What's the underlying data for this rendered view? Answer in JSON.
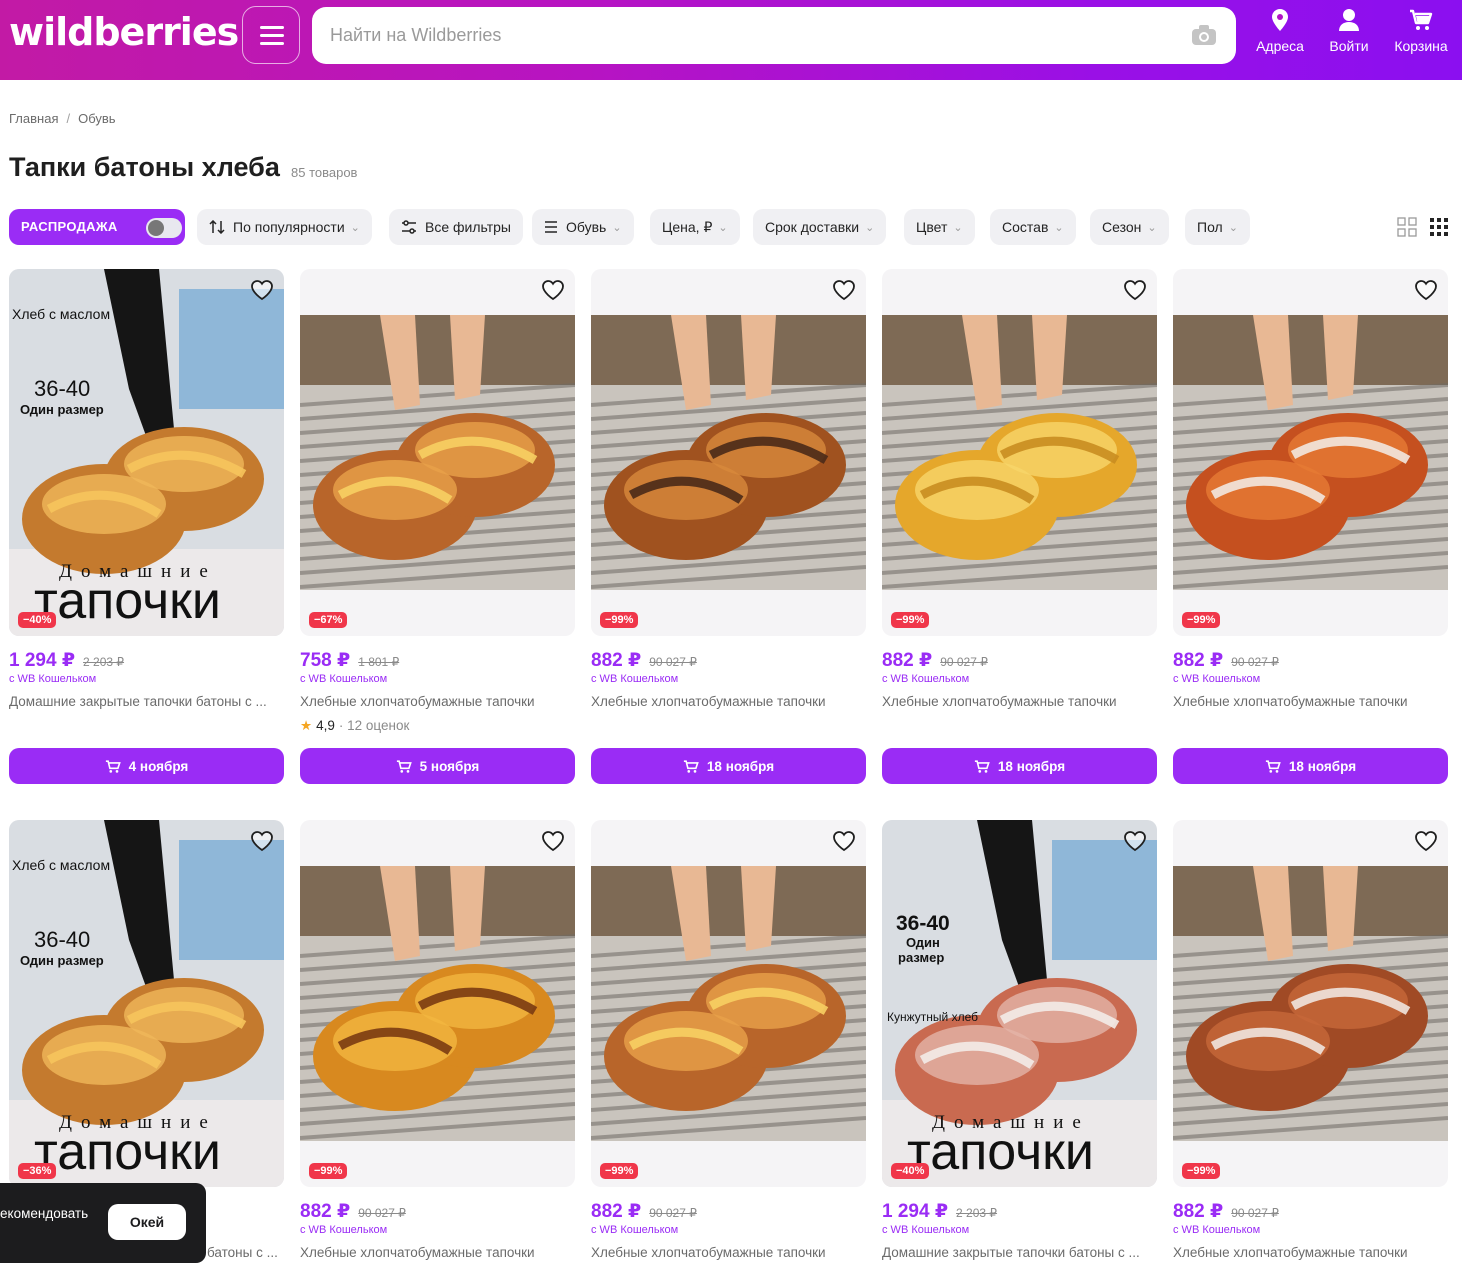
{
  "header": {
    "logo": "wildberries",
    "search_placeholder": "Найти на Wildberries",
    "address_label": "Адреса",
    "login_label": "Войти",
    "cart_label": "Корзина"
  },
  "breadcrumb": [
    "Главная",
    "Обувь"
  ],
  "page": {
    "title": "Тапки батоны хлеба",
    "count": "85 товаров"
  },
  "filters": {
    "sale_label": "РАСПРОДАЖА",
    "sale_enabled": false,
    "sort": "По популярности",
    "all_filters": "Все фильтры",
    "category": "Обувь",
    "price": "Цена, ₽",
    "delivery": "Срок доставки",
    "color": "Цвет",
    "composition": "Состав",
    "season": "Сезон",
    "gender": "Пол"
  },
  "products": [
    {
      "price": "1 294 ₽",
      "old_price": "2 203 ₽",
      "discount": "−40%",
      "wallet": "с WB Кошельком",
      "title": "Домашние закрытые тапочки батоны с ...",
      "rating": "",
      "reviews": "",
      "delivery": "4 ноября",
      "style": "baguette",
      "overlay": {
        "top": "Хлеб с маслом",
        "size": "36-40",
        "one": "Один размер",
        "small": "Домашние",
        "big": "тапочки"
      }
    },
    {
      "price": "758 ₽",
      "old_price": "1 801 ₽",
      "discount": "−67%",
      "wallet": "с WB Кошельком",
      "title": "Хлебные хлопчатобумажные тапочки",
      "rating": "4,9",
      "reviews": "· 12 оценок",
      "delivery": "5 ноября",
      "style": "loaf"
    },
    {
      "price": "882 ₽",
      "old_price": "90 027 ₽",
      "discount": "−99%",
      "wallet": "с WB Кошельком",
      "title": "Хлебные хлопчатобумажные тапочки",
      "rating": "",
      "reviews": "",
      "delivery": "18 ноября",
      "style": "choco"
    },
    {
      "price": "882 ₽",
      "old_price": "90 027 ₽",
      "discount": "−99%",
      "wallet": "с WB Кошельком",
      "title": "Хлебные хлопчатобумажные тапочки",
      "rating": "",
      "reviews": "",
      "delivery": "18 ноября",
      "style": "melon"
    },
    {
      "price": "882 ₽",
      "old_price": "90 027 ₽",
      "discount": "−99%",
      "wallet": "с WB Кошельком",
      "title": "Хлебные хлопчатобумажные тапочки",
      "rating": "",
      "reviews": "",
      "delivery": "18 ноября",
      "style": "sesame-orange"
    },
    {
      "price": "",
      "old_price": "",
      "discount": "−36%",
      "wallet": "",
      "title": "батоны с ...",
      "rating": "",
      "reviews": "",
      "delivery": "",
      "style": "baguette",
      "overlay": {
        "top": "Хлеб с маслом",
        "size": "36-40",
        "one": "Один размер",
        "small": "Домашние",
        "big": "тапочки"
      }
    },
    {
      "price": "882 ₽",
      "old_price": "90 027 ₽",
      "discount": "−99%",
      "wallet": "с WB Кошельком",
      "title": "Хлебные хлопчатобумажные тапочки",
      "rating": "",
      "reviews": "",
      "delivery": "",
      "style": "seeds"
    },
    {
      "price": "882 ₽",
      "old_price": "90 027 ₽",
      "discount": "−99%",
      "wallet": "с WB Кошельком",
      "title": "Хлебные хлопчатобумажные тапочки",
      "rating": "",
      "reviews": "",
      "delivery": "",
      "style": "loaf"
    },
    {
      "price": "1 294 ₽",
      "old_price": "2 203 ₽",
      "discount": "−40%",
      "wallet": "с WB Кошельком",
      "title": "Домашние закрытые тапочки батоны с ...",
      "rating": "",
      "reviews": "",
      "delivery": "",
      "style": "sesame-full",
      "overlay": {
        "size": "36-40",
        "one": "Один",
        "one2": "размер",
        "top": "Кунжутный хлеб",
        "small": "Домашние",
        "big": "тапочки"
      }
    },
    {
      "price": "882 ₽",
      "old_price": "90 027 ₽",
      "discount": "−99%",
      "wallet": "с WB Кошельком",
      "title": "Хлебные хлопчатобумажные тапочки",
      "rating": "",
      "reviews": "",
      "delivery": "",
      "style": "sesame-white"
    }
  ],
  "toast": {
    "text": "екомендовать",
    "ok": "Окей"
  },
  "colors": {
    "accent": "#9a2cf5",
    "discount": "#f0364a",
    "header_from": "#c21aa5",
    "header_to": "#8b0ff0"
  }
}
